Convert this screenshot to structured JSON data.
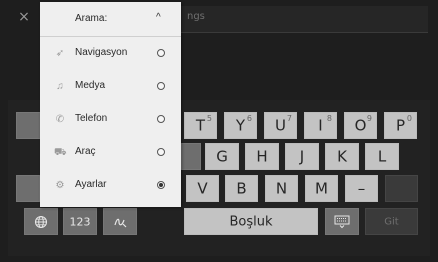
{
  "top_bar": {
    "close_glyph": "×",
    "search_hint": "ngs"
  },
  "menu": {
    "title": "Arama:",
    "caret": "^",
    "items": [
      {
        "label": "Navigasyon",
        "icon": "navigation-arrow-icon",
        "icon_glyph": "➶",
        "selected": false
      },
      {
        "label": "Medya",
        "icon": "music-note-icon",
        "icon_glyph": "♫",
        "selected": false
      },
      {
        "label": "Telefon",
        "icon": "phone-icon",
        "icon_glyph": "✆",
        "selected": false
      },
      {
        "label": "Araç",
        "icon": "car-icon",
        "icon_glyph": "⛟",
        "selected": false
      },
      {
        "label": "Ayarlar",
        "icon": "gear-icon",
        "icon_glyph": "⚙",
        "selected": true
      }
    ]
  },
  "keyboard": {
    "row1": [
      {
        "label": "T",
        "sup": "5"
      },
      {
        "label": "Y",
        "sup": "6"
      },
      {
        "label": "U",
        "sup": "7"
      },
      {
        "label": "I",
        "sup": "8"
      },
      {
        "label": "O",
        "sup": "9"
      },
      {
        "label": "P",
        "sup": "0"
      }
    ],
    "row2": [
      "G",
      "H",
      "J",
      "K",
      "L"
    ],
    "row3": [
      "V",
      "B",
      "N",
      "M",
      "–"
    ],
    "numbers_key": "123",
    "space_key": "Boşluk",
    "go_key": "Git"
  },
  "colors": {
    "key_light": "#c3c3c3",
    "key_dark": "#6e6e6e",
    "background": "#1e1e1e",
    "menu_bg": "#efefef"
  }
}
